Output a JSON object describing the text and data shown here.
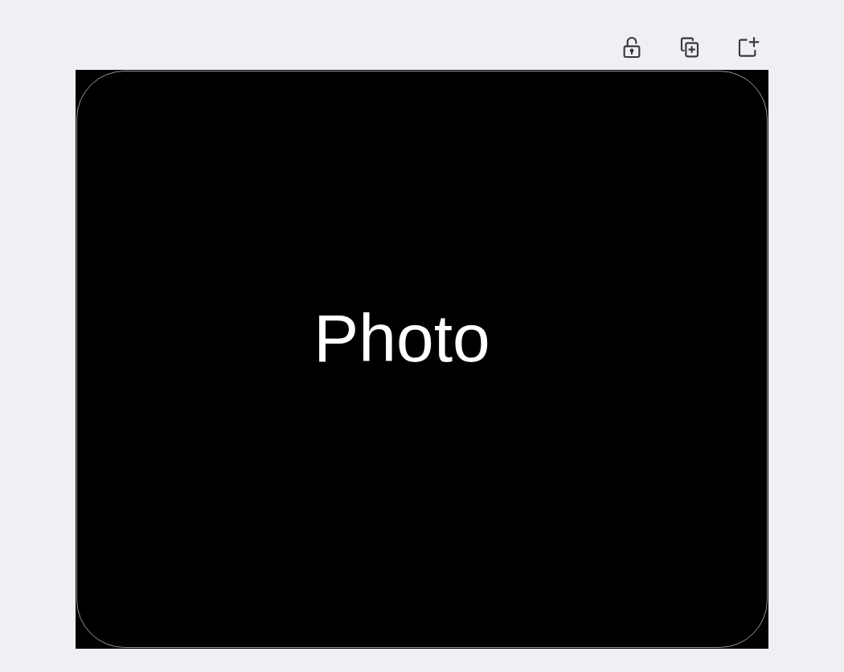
{
  "toolbar": {
    "buttons": [
      {
        "kind": "unlock"
      },
      {
        "kind": "duplicate"
      },
      {
        "kind": "add"
      }
    ]
  },
  "canvas": {
    "label": "Photo"
  }
}
